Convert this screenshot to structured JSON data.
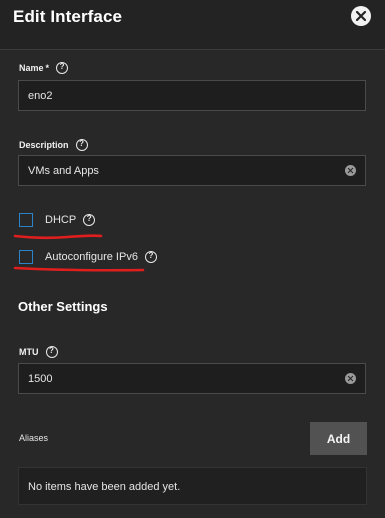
{
  "header": {
    "title": "Edit Interface"
  },
  "name_field": {
    "label": "Name",
    "required_mark": "*",
    "value": "eno2"
  },
  "description_field": {
    "label": "Description",
    "value": "VMs and Apps"
  },
  "dhcp": {
    "label": "DHCP",
    "checked": false
  },
  "ipv6": {
    "label": "Autoconfigure IPv6",
    "checked": false
  },
  "other_settings": {
    "title": "Other Settings"
  },
  "mtu_field": {
    "label": "MTU",
    "value": "1500"
  },
  "aliases": {
    "label": "Aliases",
    "add_label": "Add",
    "empty_text": "No items have been added yet."
  },
  "colors": {
    "checkbox_border": "#2c83c8",
    "annotation_red": "#e01e1e",
    "background": "#282828"
  }
}
